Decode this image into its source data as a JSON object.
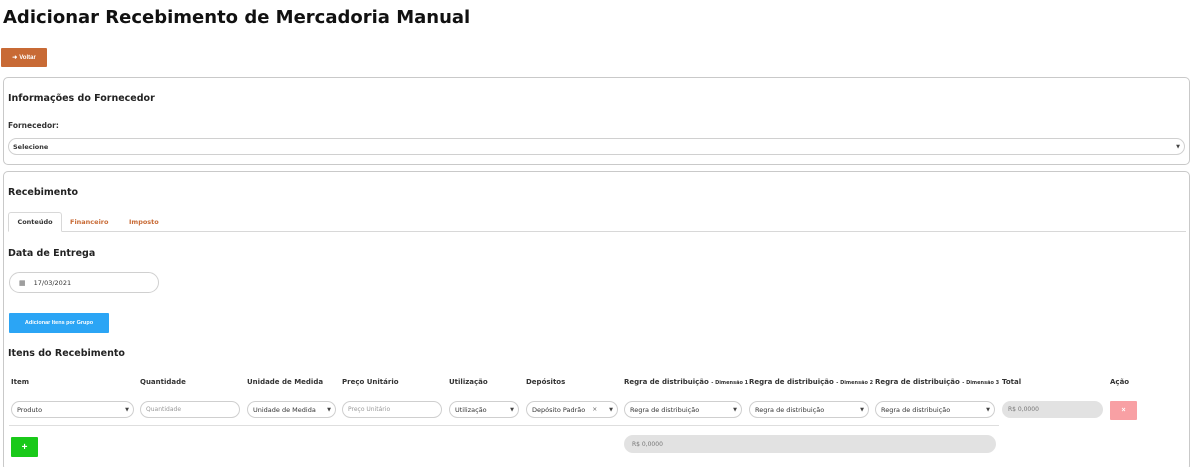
{
  "page": {
    "title": "Adicionar Recebimento de Mercadoria Manual"
  },
  "back_button": {
    "label": "Voltar",
    "icon": "arrow-left-icon"
  },
  "supplier": {
    "section_title": "Informações do Fornecedor",
    "field_label": "Fornecedor:",
    "selected": "Selecione"
  },
  "receipt": {
    "section_title": "Recebimento",
    "tabs": [
      {
        "label": "Conteúdo",
        "active": true
      },
      {
        "label": "Financeiro",
        "active": false
      },
      {
        "label": "Imposto",
        "active": false
      }
    ],
    "delivery_date_label": "Data de Entrega",
    "delivery_date": "17/03/2021",
    "add_group_button": "Adicionar Itens por Grupo",
    "items_title": "Itens do Recebimento",
    "columns": {
      "item": "Item",
      "quantity": "Quantidade",
      "unit": "Unidade de Medida",
      "unit_price": "Preço Unitário",
      "usage": "Utilização",
      "deposits": "Depósitos",
      "rule_main": "Regra de distribuição",
      "dim1": "- Dimensão 1",
      "dim2": "- Dimensão 2",
      "dim3": "- Dimensão 3",
      "total": "Total",
      "action": "Ação"
    },
    "row": {
      "item": "Produto",
      "quantity_placeholder": "Quantidade",
      "unit": "Unidade de Medida",
      "unit_price_placeholder": "Preço Unitário",
      "usage": "Utilização",
      "deposit": "Depósito Padrão",
      "rule1": "Regra de distribuição",
      "rule2": "Regra de distribuição",
      "rule3": "Regra de distribuição",
      "total": "R$ 0,0000",
      "delete_label": "×"
    },
    "add_row_label": "+",
    "grand_total": "R$ 0,0000"
  },
  "colors": {
    "back_button": "#c86a35",
    "tab_link": "#c86a35",
    "add_group_button": "#2ba5f5",
    "delete_button": "#f8a0a4",
    "add_button": "#19c919"
  }
}
